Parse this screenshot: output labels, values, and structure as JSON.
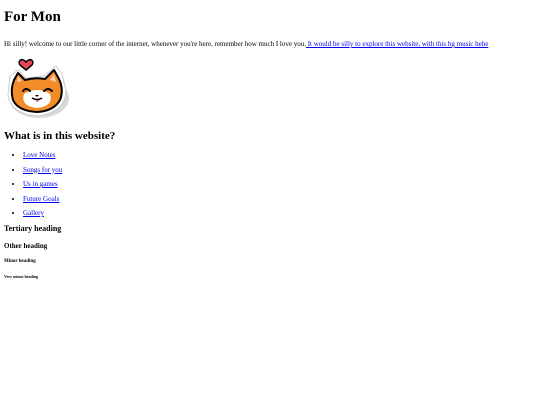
{
  "header": {
    "title": "For Mon"
  },
  "intro": {
    "text": "Hi silly! welcome to our little corner of the internet, whenever you're here, remember how much I love you.",
    "link_text": " It would be silly to explore this website, with this bg music hehe"
  },
  "sticker": {
    "icon": "cat-heart-sticker-icon",
    "colors": {
      "fur": "#f28c28",
      "outline": "#000000",
      "heart": "#e8445a",
      "face": "#ffffff"
    }
  },
  "section": {
    "heading": "What is in this website?"
  },
  "nav": {
    "items": [
      {
        "label": " Love Notes"
      },
      {
        "label": " Songs for you"
      },
      {
        "label": " Us in games"
      },
      {
        "label": " Future Goals"
      },
      {
        "label": " Gallery"
      }
    ]
  },
  "headings": {
    "tertiary": "Tertiary heading",
    "other": "Other heading",
    "minor": "Minor heading",
    "very_minor": "Very minor heading"
  },
  "colors": {
    "link": "#0000ee",
    "text": "#000000",
    "background": "#ffffff"
  }
}
